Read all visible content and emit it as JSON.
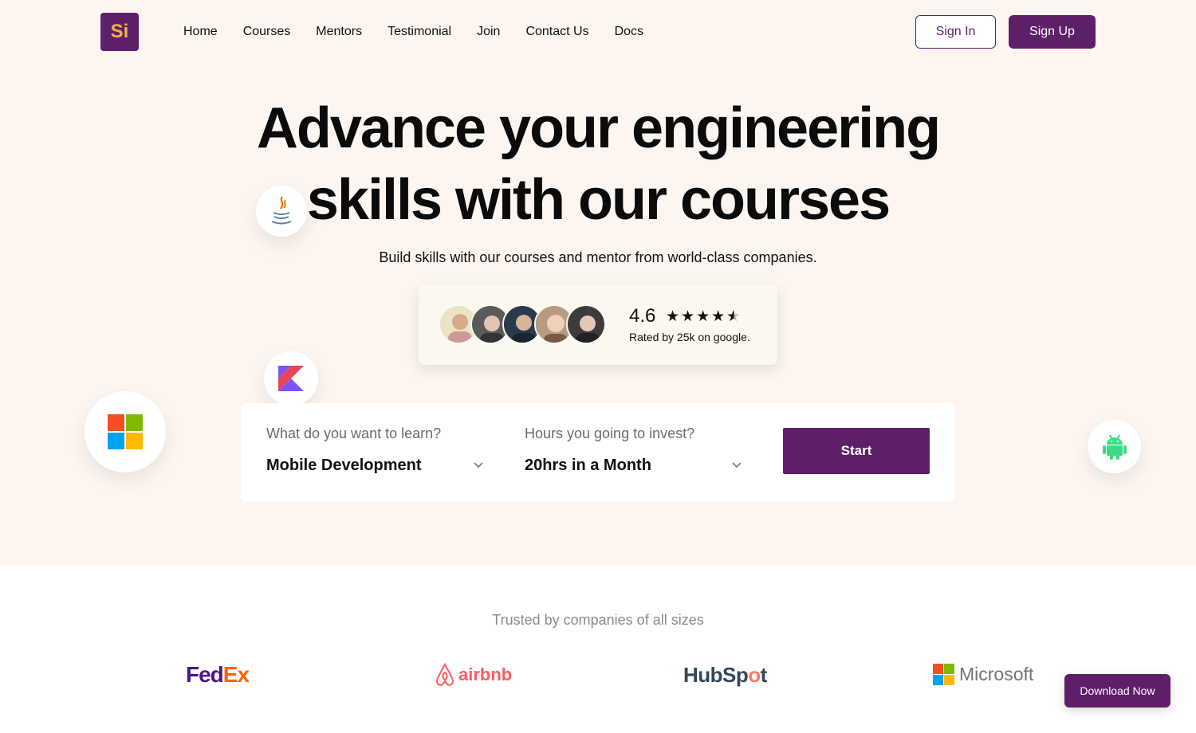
{
  "logo": {
    "text": "Si"
  },
  "nav": {
    "items": [
      "Home",
      "Courses",
      "Mentors",
      "Testimonial",
      "Join",
      "Contact Us",
      "Docs"
    ]
  },
  "auth": {
    "sign_in": "Sign In",
    "sign_up": "Sign Up"
  },
  "hero": {
    "headline_line1": "Advance your engineering",
    "headline_line2": "skills with our courses",
    "subtitle": "Build skills with our courses and mentor from world-class companies."
  },
  "rating": {
    "value": "4.6",
    "stars": "★★★★★",
    "stars_filled": 4.5,
    "caption": "Rated by 25k on google."
  },
  "search": {
    "learn_label": "What do you want to learn?",
    "learn_value": "Mobile Development",
    "hours_label": "Hours you going to invest?",
    "hours_value": "20hrs in a Month",
    "start_label": "Start"
  },
  "trusted": {
    "title": "Trusted by companies of all sizes",
    "logos": {
      "fedex_fe": "Fed",
      "fedex_ex": "Ex",
      "airbnb": "airbnb",
      "hubspot_a": "HubSp",
      "hubspot_o": "o",
      "hubspot_b": "t",
      "microsoft": "Microsoft"
    }
  },
  "download": {
    "label": "Download Now"
  },
  "colors": {
    "brand": "#5e1f69",
    "hero_bg": "#fcf5f0",
    "logo_letter": "#f4b24a"
  },
  "icons": [
    "java-icon",
    "kotlin-icon",
    "microsoft-icon",
    "android-icon",
    "chevron-down-icon"
  ]
}
